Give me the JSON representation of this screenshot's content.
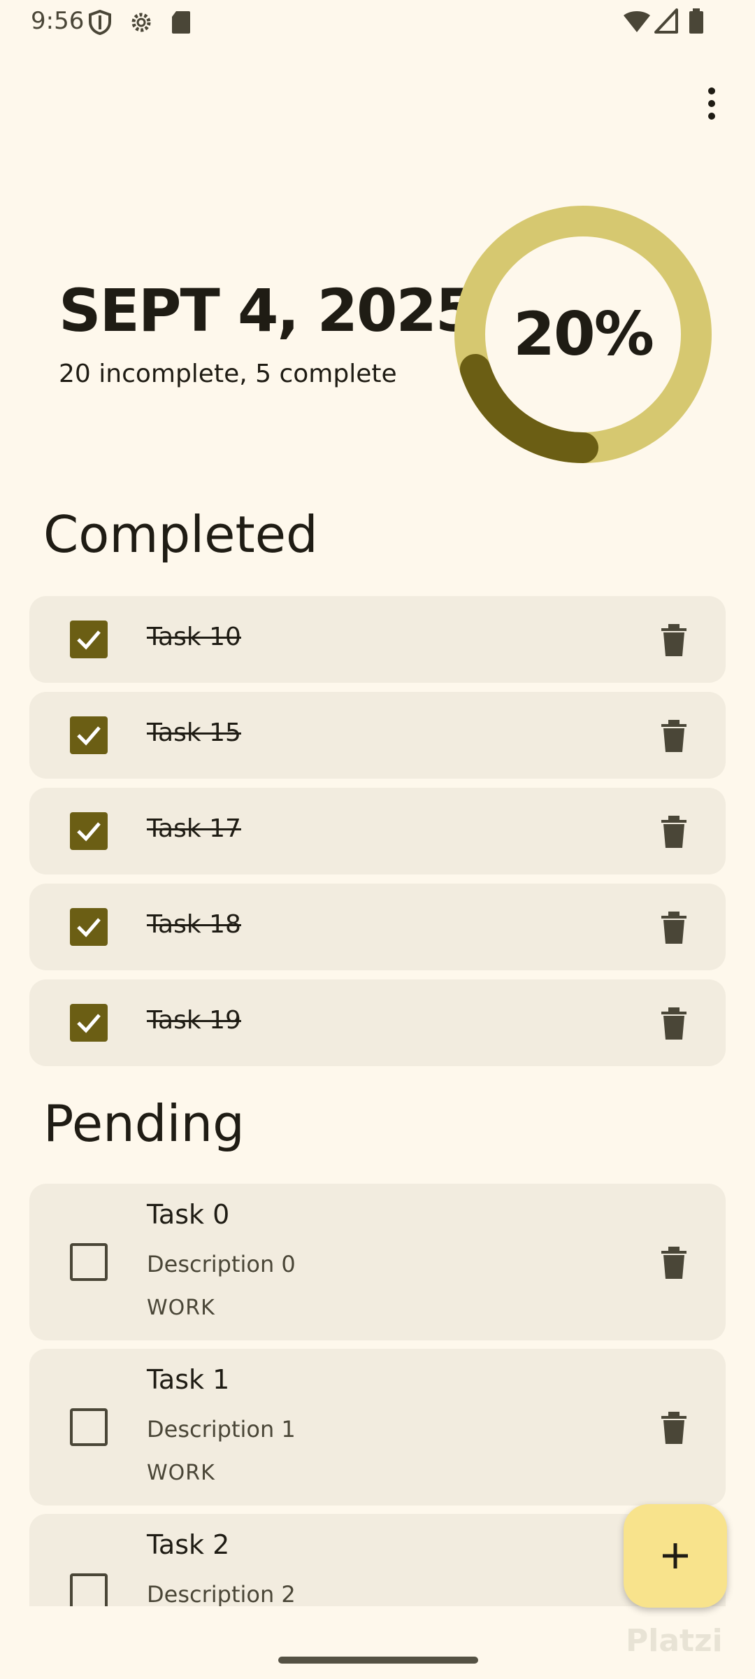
{
  "status_bar": {
    "time": "9:56"
  },
  "header": {
    "date": "SEPT 4, 2025",
    "summary": "20 incomplete, 5 complete",
    "progress_label": "20%",
    "progress_fraction": 0.2
  },
  "sections": {
    "completed_title": "Completed",
    "pending_title": "Pending"
  },
  "completed_tasks": [
    {
      "title": "Task 10"
    },
    {
      "title": "Task 15"
    },
    {
      "title": "Task 17"
    },
    {
      "title": "Task 18"
    },
    {
      "title": "Task 19"
    }
  ],
  "pending_tasks": [
    {
      "title": "Task 0",
      "description": "Description 0",
      "category": "WORK"
    },
    {
      "title": "Task 1",
      "description": "Description 1",
      "category": "WORK"
    },
    {
      "title": "Task 2",
      "description": "Description 2",
      "category": ""
    }
  ],
  "watermark": "Platzi",
  "colors": {
    "background": "#FEF8EC",
    "card": "#F2ECDF",
    "accent": "#6B5E14",
    "ring_track": "#D6C870",
    "fab": "#F8E38C"
  }
}
